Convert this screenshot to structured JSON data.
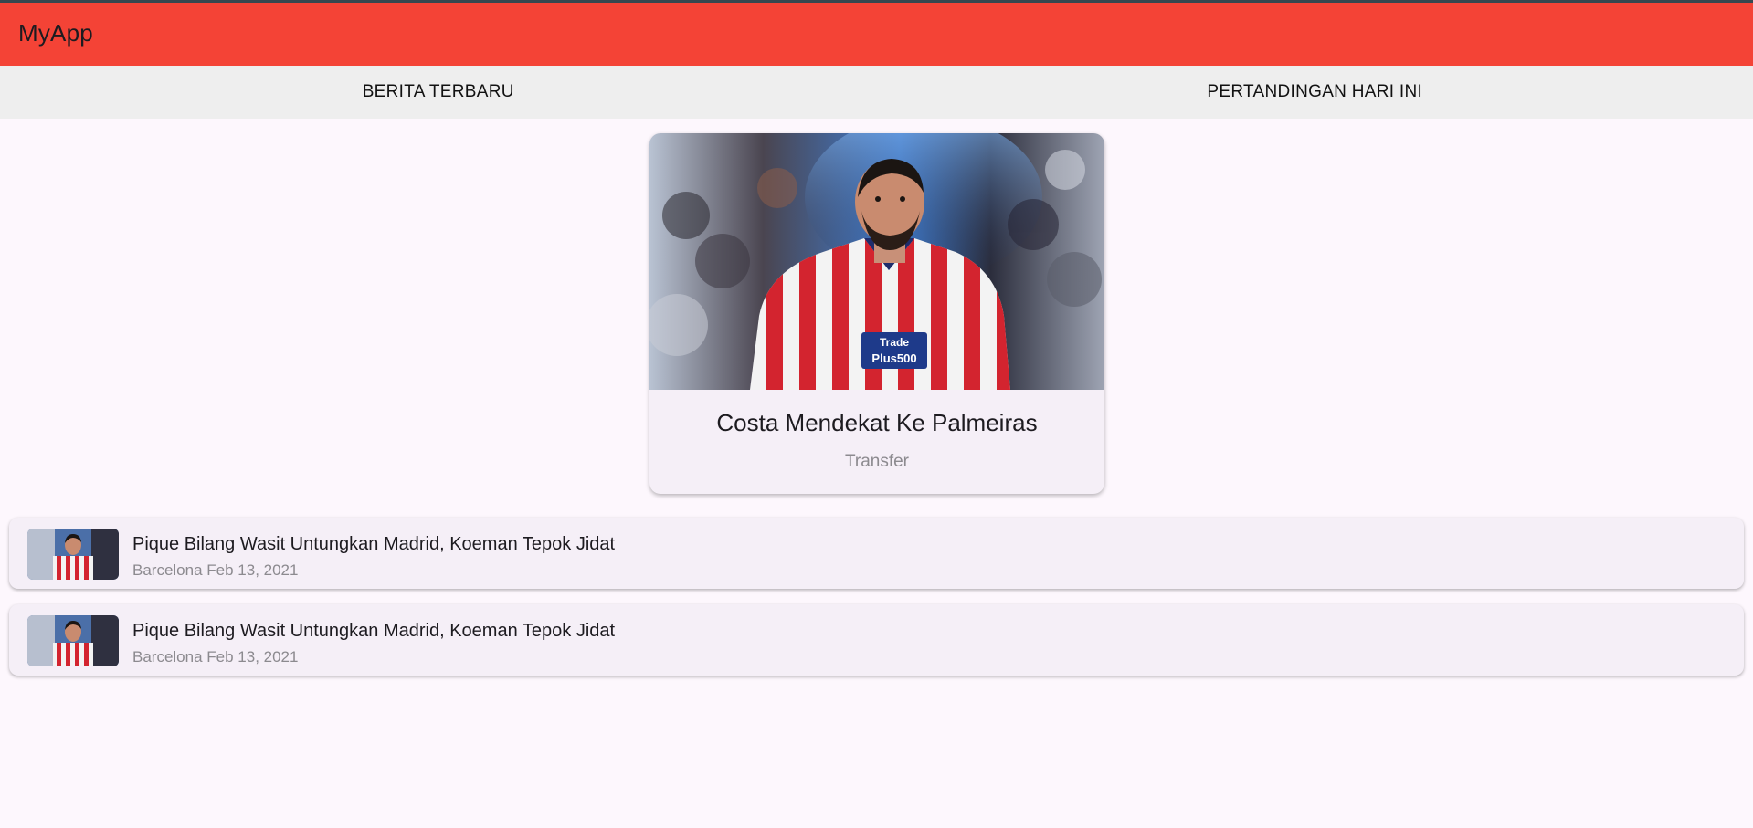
{
  "app": {
    "title": "MyApp",
    "colors": {
      "appbar": "#f44336",
      "tabbar": "#eeeeee",
      "background": "#fdf7fd",
      "card": "#f5eff7"
    }
  },
  "tabs": [
    {
      "label": "BERITA TERBARU"
    },
    {
      "label": "PERTANDINGAN HARI INI"
    }
  ],
  "featured": {
    "title": "Costa Mendekat Ke Palmeiras",
    "category": "Transfer",
    "jersey_text": [
      "Trade",
      "Plus500"
    ]
  },
  "news_list": [
    {
      "title": "Pique Bilang Wasit Untungkan Madrid, Koeman Tepok Jidat",
      "subtitle": "Barcelona Feb 13, 2021"
    },
    {
      "title": "Pique Bilang Wasit Untungkan Madrid, Koeman Tepok Jidat",
      "subtitle": "Barcelona Feb 13, 2021"
    }
  ]
}
